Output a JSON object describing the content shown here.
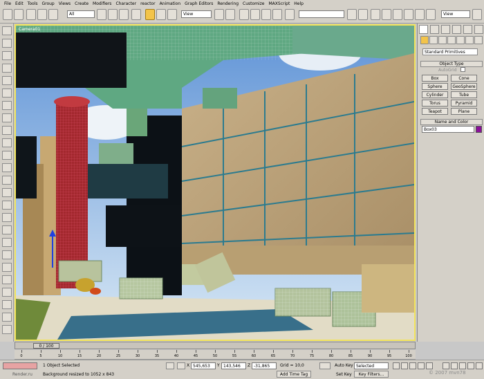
{
  "menu": {
    "items": [
      "File",
      "Edit",
      "Tools",
      "Group",
      "Views",
      "Create",
      "Modifiers",
      "Character",
      "reactor",
      "Animation",
      "Graph Editors",
      "Rendering",
      "Customize",
      "MAXScript",
      "Help"
    ]
  },
  "toolbar": {
    "selection_filter": "All",
    "ref_coord": "View",
    "named_selection": "",
    "render_view": "View"
  },
  "viewport": {
    "label": "Camera01"
  },
  "command_panel": {
    "category": "Standard Primitives",
    "object_type_title": "Object Type",
    "autogrid_label": "AutoGrid",
    "buttons": [
      "Box",
      "Cone",
      "Sphere",
      "GeoSphere",
      "Cylinder",
      "Tube",
      "Torus",
      "Pyramid",
      "Teapot",
      "Plane"
    ],
    "name_color_title": "Name and Color",
    "object_name": "Box03",
    "object_color": "#8b0f9a"
  },
  "timeline": {
    "frame_display": "0 / 100",
    "ticks": [
      "0",
      "5",
      "10",
      "15",
      "20",
      "25",
      "30",
      "35",
      "40",
      "45",
      "50",
      "55",
      "60",
      "65",
      "70",
      "75",
      "80",
      "85",
      "90",
      "95",
      "100"
    ]
  },
  "status": {
    "selection_text": "1 Object Selected",
    "prompt_text": "Background resized to 1052 x 843",
    "x_label": "X",
    "x_value": "545,653",
    "y_label": "Y",
    "y_value": "143,546",
    "z_label": "Z",
    "z_value": "-31,865",
    "grid_text": "Grid = 10,0",
    "add_time_tag": "Add Time Tag",
    "auto_key": "Auto Key",
    "selected": "Selected",
    "set_key": "Set Key",
    "key_filters": "Key Filters...",
    "frame": "0",
    "render_site": "Render.ru"
  },
  "watermark": "© 2007 mvn78",
  "colors": {
    "viewport_border": "#f2e35a",
    "active_tool": "#f3c44a",
    "ui_gray": "#d4d0c8"
  }
}
